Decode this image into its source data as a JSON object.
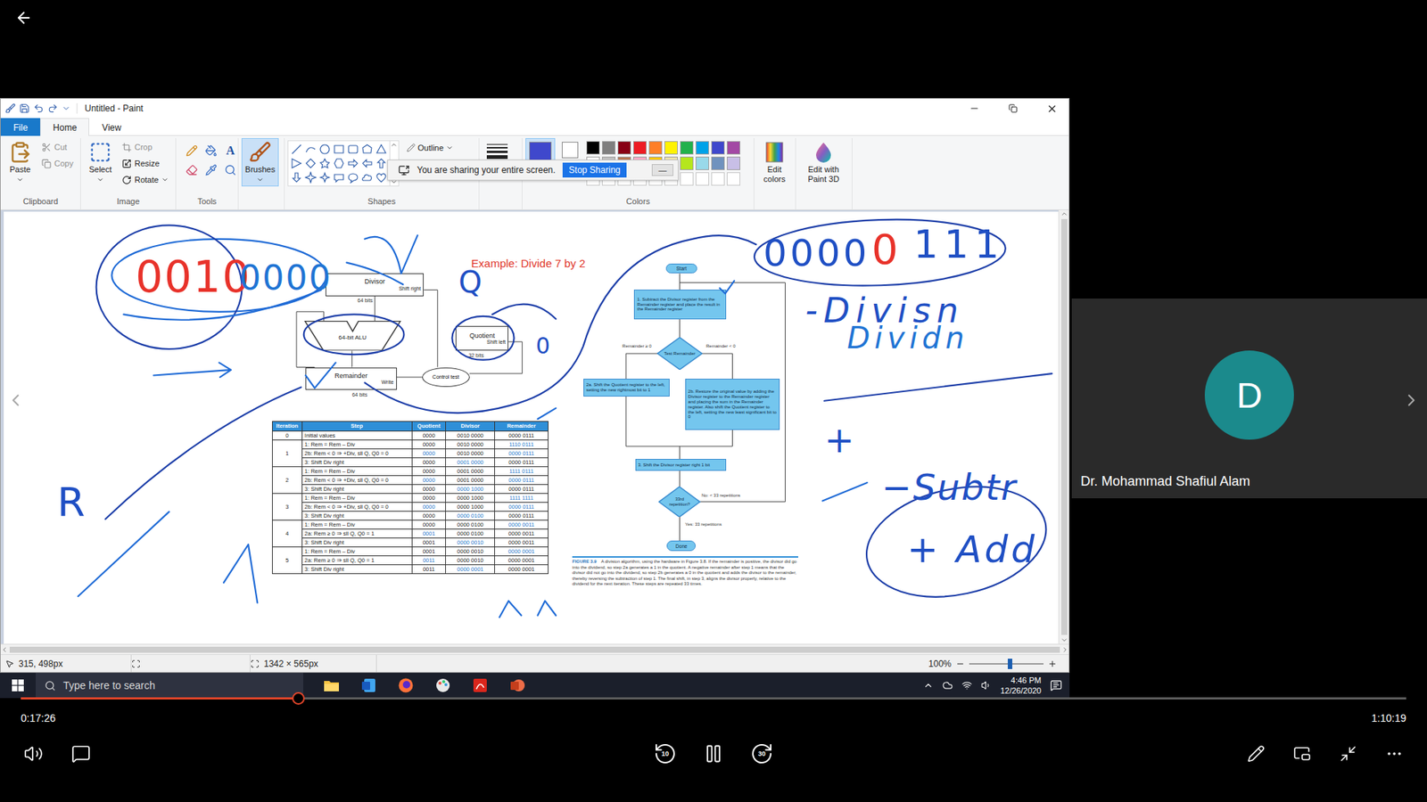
{
  "player": {
    "time_current": "0:17:26",
    "time_total": "1:10:19",
    "progress": {
      "level": 0.2
    },
    "playing": true,
    "skip_back": "10",
    "skip_forward": "30"
  },
  "participant": {
    "initial": "D",
    "name": "Dr. Mohammad Shafiul Alam",
    "color": "#1b8a8c"
  },
  "paint": {
    "title": "Untitled - Paint",
    "menu": [
      {
        "label": "File",
        "selected": false
      },
      {
        "label": "Home",
        "selected": true
      },
      {
        "label": "View",
        "selected": false
      }
    ],
    "clipboard": {
      "label": "Clipboard",
      "paste": "Paste",
      "cut": {
        "label": "Cut",
        "disabled": true
      },
      "copy": {
        "label": "Copy",
        "disabled": true
      }
    },
    "image": {
      "label": "Image",
      "select": "Select",
      "crop": {
        "label": "Crop",
        "disabled": true
      },
      "resize": {
        "label": "Resize",
        "disabled": false
      },
      "rotate": {
        "label": "Rotate",
        "disabled": false
      }
    },
    "tools": {
      "label": "Tools",
      "text_tool": "A"
    },
    "brushes": {
      "label": "Brushes",
      "selected": true
    },
    "shapes": {
      "label": "Shapes",
      "outline": "Outline"
    },
    "colors": {
      "label": "Colors",
      "color1": {
        "label": "1",
        "color": "#3f48cc",
        "selected": true
      },
      "color2": {
        "label": "2",
        "color": "#ffffff",
        "selected": false
      },
      "palette": [
        "#000000",
        "#7f7f7f",
        "#880015",
        "#ed1c24",
        "#ff7f27",
        "#fff200",
        "#22b14c",
        "#00a2e8",
        "#3f48cc",
        "#a349a4",
        "#ffffff",
        "#c3c3c3",
        "#b97a57",
        "#ffaec9",
        "#ffc90e",
        "#efe4b0",
        "#b5e61d",
        "#99d9ea",
        "#7092be",
        "#c8bfe7"
      ],
      "edit_colors": "Edit colors",
      "paint3d": "Edit with Paint 3D"
    },
    "sharing": {
      "text": "You are sharing your entire screen.",
      "button": "Stop Sharing",
      "minimize": "—"
    },
    "status": {
      "cursor": "315, 498px",
      "size": "1342 × 565px",
      "zoom": "100%",
      "zoom_slider": {
        "level": 0.55
      }
    }
  },
  "slide": {
    "title": "Example: Divide 7 by 2",
    "hardware": {
      "divisor": "Divisor",
      "divisor_op": "Shift right",
      "divisor_bits": "64 bits",
      "alu": "64-bit ALU",
      "quotient": "Quotient",
      "quotient_op": "Shift left",
      "quotient_bits": "32 bits",
      "remainder": "Remainder",
      "remainder_op": "Write",
      "remainder_bits": "64 bits",
      "control": "Control test"
    },
    "table": {
      "columns": [
        "Iteration",
        "Step",
        "Quotient",
        "Divisor",
        "Remainder"
      ],
      "groups": [
        {
          "iteration": "0",
          "steps": [
            {
              "step": "Initial values",
              "quotient": "0000",
              "divisor": "0010 0000",
              "remainder": "0000 0111",
              "changed": []
            }
          ]
        },
        {
          "iteration": "1",
          "steps": [
            {
              "step": "1: Rem = Rem – Div",
              "quotient": "0000",
              "divisor": "0010 0000",
              "remainder": "1110 0111",
              "changed": [
                "remainder"
              ]
            },
            {
              "step": "2b: Rem < 0 ⇒ +Div, sll Q, Q0 = 0",
              "quotient": "0000",
              "divisor": "0010 0000",
              "remainder": "0000 0111",
              "changed": [
                "quotient",
                "remainder"
              ]
            },
            {
              "step": "3: Shift Div right",
              "quotient": "0000",
              "divisor": "0001 0000",
              "remainder": "0000 0111",
              "changed": [
                "divisor"
              ]
            }
          ]
        },
        {
          "iteration": "2",
          "steps": [
            {
              "step": "1: Rem = Rem – Div",
              "quotient": "0000",
              "divisor": "0001 0000",
              "remainder": "1111 0111",
              "changed": [
                "remainder"
              ]
            },
            {
              "step": "2b: Rem < 0 ⇒ +Div, sll Q, Q0 = 0",
              "quotient": "0000",
              "divisor": "0001 0000",
              "remainder": "0000 0111",
              "changed": [
                "quotient",
                "remainder"
              ]
            },
            {
              "step": "3: Shift Div right",
              "quotient": "0000",
              "divisor": "0000 1000",
              "remainder": "0000 0111",
              "changed": [
                "divisor"
              ]
            }
          ]
        },
        {
          "iteration": "3",
          "steps": [
            {
              "step": "1: Rem = Rem – Div",
              "quotient": "0000",
              "divisor": "0000 1000",
              "remainder": "1111 1111",
              "changed": [
                "remainder"
              ]
            },
            {
              "step": "2b: Rem < 0 ⇒ +Div, sll Q, Q0 = 0",
              "quotient": "0000",
              "divisor": "0000 1000",
              "remainder": "0000 0111",
              "changed": [
                "quotient",
                "remainder"
              ]
            },
            {
              "step": "3: Shift Div right",
              "quotient": "0000",
              "divisor": "0000 0100",
              "remainder": "0000 0111",
              "changed": [
                "divisor"
              ]
            }
          ]
        },
        {
          "iteration": "4",
          "steps": [
            {
              "step": "1: Rem = Rem – Div",
              "quotient": "0000",
              "divisor": "0000 0100",
              "remainder": "0000 0011",
              "changed": [
                "remainder"
              ]
            },
            {
              "step": "2a: Rem ≥ 0 ⇒ sll Q, Q0 = 1",
              "quotient": "0001",
              "divisor": "0000 0100",
              "remainder": "0000 0011",
              "changed": [
                "quotient"
              ]
            },
            {
              "step": "3: Shift Div right",
              "quotient": "0001",
              "divisor": "0000 0010",
              "remainder": "0000 0011",
              "changed": [
                "divisor"
              ]
            }
          ]
        },
        {
          "iteration": "5",
          "steps": [
            {
              "step": "1: Rem = Rem – Div",
              "quotient": "0001",
              "divisor": "0000 0010",
              "remainder": "0000 0001",
              "changed": [
                "remainder"
              ]
            },
            {
              "step": "2a: Rem ≥ 0 ⇒ sll Q, Q0 = 1",
              "quotient": "0011",
              "divisor": "0000 0010",
              "remainder": "0000 0001",
              "changed": [
                "quotient"
              ]
            },
            {
              "step": "3: Shift Div right",
              "quotient": "0011",
              "divisor": "0000 0001",
              "remainder": "0000 0001",
              "changed": [
                "divisor"
              ]
            }
          ]
        }
      ]
    },
    "flowchart": {
      "start": "Start",
      "step1": "1. Subtract the Divisor register from the Remainder register and place the result in the Remainder register",
      "test": "Test Remainder",
      "yes_branch": "Remainder ≥ 0",
      "no_branch": "Remainder < 0",
      "step2a": "2a. Shift the Quotient register to the left, setting the new rightmost bit to 1",
      "step2b": "2b. Restore the original value by adding the Divisor register to the Remainder register and placing the sum in the Remainder register. Also shift the Quotient register to the left, setting the new least significant bit to 0",
      "step3": "3. Shift the Divisor register right 1 bit",
      "repeat": "33rd repetition?",
      "no_repeat": "No: < 33 repetitions",
      "yes_repeat": "Yes: 33 repetitions",
      "done": "Done"
    },
    "caption": {
      "label": "FIGURE 3.9",
      "text": "A division algorithm, using the hardware in Figure 3.8. If the remainder is positive, the divisor did go into the dividend, so step 2a generates a 1 in the quotient. A negative remainder after step 1 means that the divisor did not go into the dividend, so step 2b generates a 0 in the quotient and adds the divisor to the remainder, thereby reversing the subtraction of step 1. The final shift, in step 3, aligns the divisor properly, relative to the dividend for the next iteration. These steps are repeated 33 times."
    }
  },
  "annotations": [
    {
      "text": "0010",
      "color": "#e8322a"
    },
    {
      "text": "0000",
      "color": "#1f74d4"
    },
    {
      "text": "0000",
      "color": "#1f4fc4"
    },
    {
      "text": "0",
      "color": "#e8322a"
    },
    {
      "text": "111",
      "color": "#1f4fc4"
    },
    {
      "text": "-Divisn",
      "color": "#1f4fc4"
    },
    {
      "text": "Dividn",
      "color": "#1f74d4"
    },
    {
      "text": "0",
      "color": "#1f4fc4"
    },
    {
      "text": "Q",
      "color": "#1f4fc4"
    },
    {
      "text": "R",
      "color": "#1f4fc4"
    },
    {
      "text": "+",
      "color": "#1f4fc4"
    },
    {
      "text": "−Subtr",
      "color": "#1f4fc4"
    },
    {
      "text": "+ Add",
      "color": "#1f4fc4"
    }
  ],
  "taskbar": {
    "search": "Type here to search",
    "time": "4:46 PM",
    "date": "12/26/2020"
  }
}
